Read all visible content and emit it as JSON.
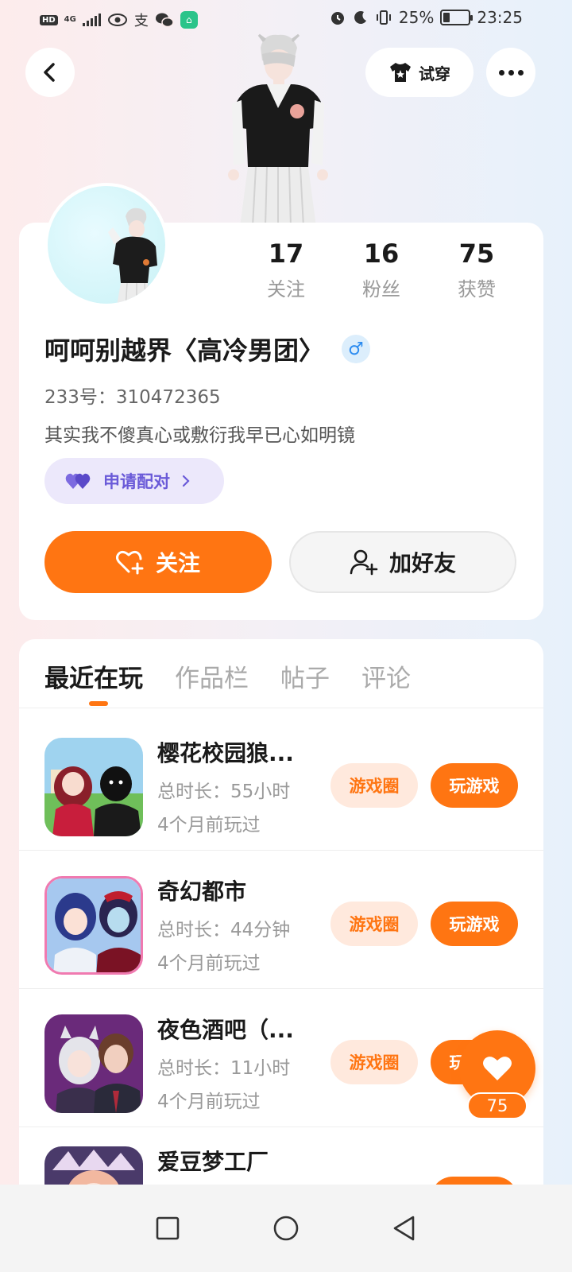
{
  "status_bar": {
    "hd": "HD",
    "network": "4G",
    "app_badge": "支",
    "battery_percent": "25%",
    "battery_level": 0.25,
    "time": "23:25"
  },
  "top_bar": {
    "try_on_label": "试穿"
  },
  "profile": {
    "stats": [
      {
        "value": "17",
        "label": "关注"
      },
      {
        "value": "16",
        "label": "粉丝"
      },
      {
        "value": "75",
        "label": "获赞"
      }
    ],
    "username": "呵呵别越界〈高冷男团〉",
    "gender_symbol": "♂",
    "uid": "233号：310472365",
    "bio": "其实我不傻真心或敷衍我早已心如明镜",
    "pair_label": "申请配对",
    "follow_label": "关注",
    "add_friend_label": "加好友"
  },
  "tabs": [
    "最近在玩",
    "作品栏",
    "帖子",
    "评论"
  ],
  "games": [
    {
      "title": "樱花校园狼...",
      "duration": "总时长：55小时",
      "last_played": "4个月前玩过",
      "circle_label": "游戏圈",
      "play_label": "玩游戏"
    },
    {
      "title": "奇幻都市",
      "duration": "总时长：44分钟",
      "last_played": "4个月前玩过",
      "circle_label": "游戏圈",
      "play_label": "玩游戏"
    },
    {
      "title": "夜色酒吧（...",
      "duration": "总时长：11小时",
      "last_played": "4个月前玩过",
      "circle_label": "游戏圈",
      "play_label": "玩游戏"
    },
    {
      "title": "爱豆梦工厂",
      "duration": "",
      "last_played": "",
      "circle_label": "",
      "play_label": ""
    }
  ],
  "floating_like": {
    "count": "75"
  },
  "colors": {
    "accent": "#ff7512",
    "pair_purple": "#6a5ad8",
    "gender_blue": "#2d8cf0"
  }
}
